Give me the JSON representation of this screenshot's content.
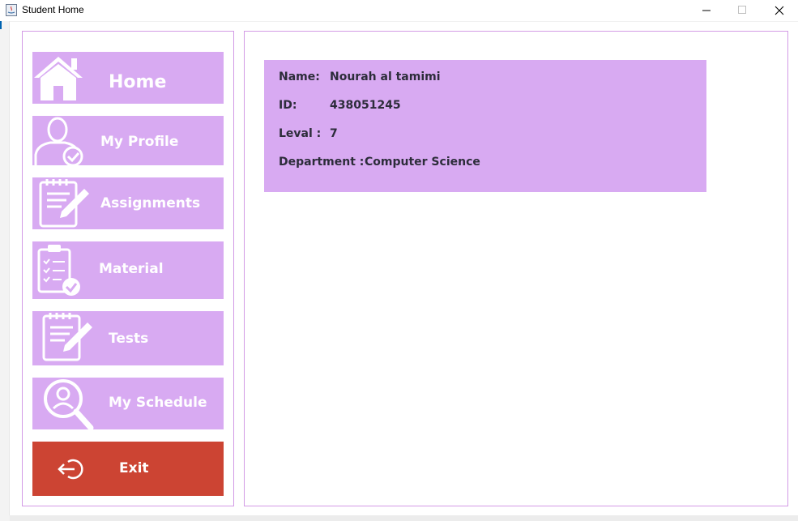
{
  "window": {
    "title": "Student Home"
  },
  "nav": {
    "home": "Home",
    "profile": "My Profile",
    "assignments": "Assignments",
    "material": "Material",
    "tests": "Tests",
    "schedule": "My Schedule",
    "exit": "Exit"
  },
  "student": {
    "name_label": "Name:",
    "name_value": "Nourah al tamimi",
    "id_label": "ID:",
    "id_value": "438051245",
    "level_label": "Leval :",
    "level_value": "7",
    "department_label": "Department :",
    "department_value": "Computer Science"
  },
  "colors": {
    "nav_bg": "#d8aaf2",
    "exit_bg": "#cc4433",
    "panel_border": "#d39be6"
  }
}
